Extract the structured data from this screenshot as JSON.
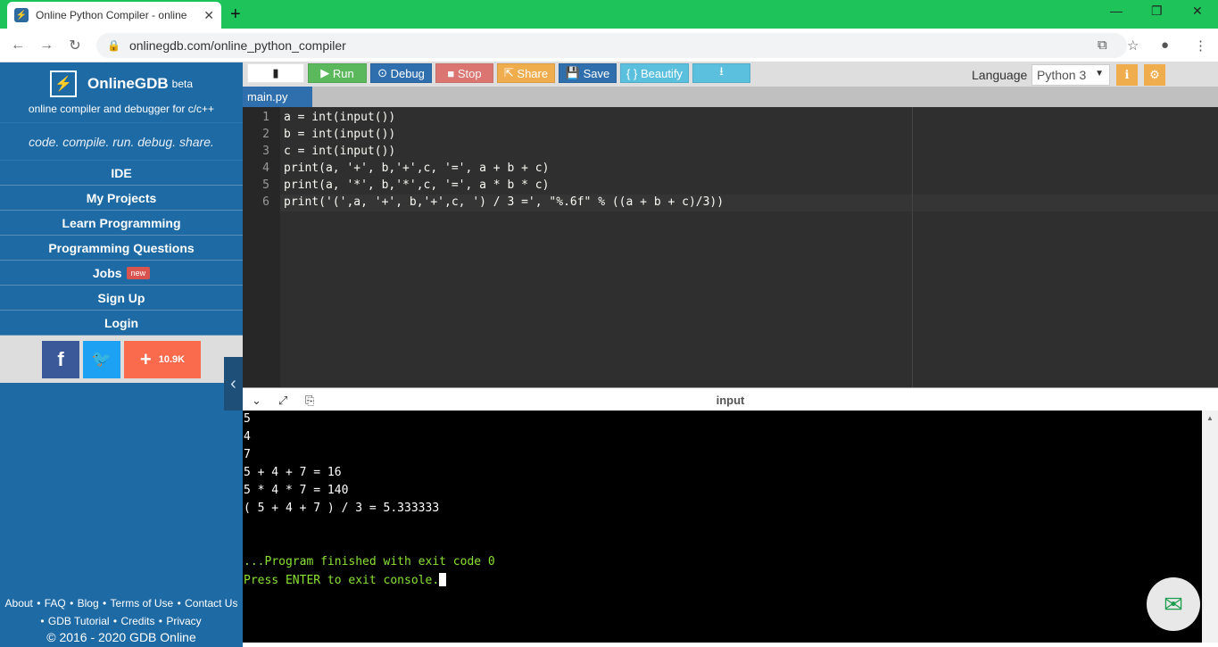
{
  "browser": {
    "tab_title": "Online Python Compiler - online",
    "url": "onlinegdb.com/online_python_compiler"
  },
  "sidebar": {
    "brand_name": "OnlineGDB",
    "brand_beta": "beta",
    "brand_sub": "online compiler and debugger for c/c++",
    "tagline": "code. compile. run. debug. share.",
    "menu": [
      {
        "label": "IDE"
      },
      {
        "label": "My Projects"
      },
      {
        "label": "Learn Programming"
      },
      {
        "label": "Programming Questions"
      },
      {
        "label": "Jobs",
        "badge": "new"
      },
      {
        "label": "Sign Up"
      },
      {
        "label": "Login"
      }
    ],
    "share_count": "10.9K",
    "footer": {
      "about": "About",
      "faq": "FAQ",
      "blog": "Blog",
      "terms": "Terms of Use",
      "contact": "Contact Us",
      "tutorial": "GDB Tutorial",
      "credits": "Credits",
      "privacy": "Privacy",
      "copyright": "© 2016 - 2020 GDB Online"
    }
  },
  "toolbar": {
    "run": "Run",
    "debug": "Debug",
    "stop": "Stop",
    "share": "Share",
    "save": "Save",
    "beautify": "{ } Beautify",
    "language_label": "Language",
    "language_value": "Python 3"
  },
  "editor": {
    "file_tab": "main.py",
    "line_numbers": [
      "1",
      "2",
      "3",
      "4",
      "5",
      "6"
    ],
    "lines": [
      "a = int(input())",
      "b = int(input())",
      "c = int(input())",
      "print(a, '+', b,'+',c, '=', a + b + c)",
      "print(a, '*', b,'*',c, '=', a * b * c)",
      "print('(',a, '+', b,'+',c, ') / 3 =', \"%.6f\" % ((a + b + c)/3))"
    ]
  },
  "console": {
    "title": "input",
    "output": [
      "5",
      "4",
      "7",
      "5 + 4 + 7 = 16",
      "5 * 4 * 7 = 140",
      "( 5 + 4 + 7 ) / 3 = 5.333333"
    ],
    "finished": "...Program finished with exit code 0",
    "press_enter": "Press ENTER to exit console."
  }
}
